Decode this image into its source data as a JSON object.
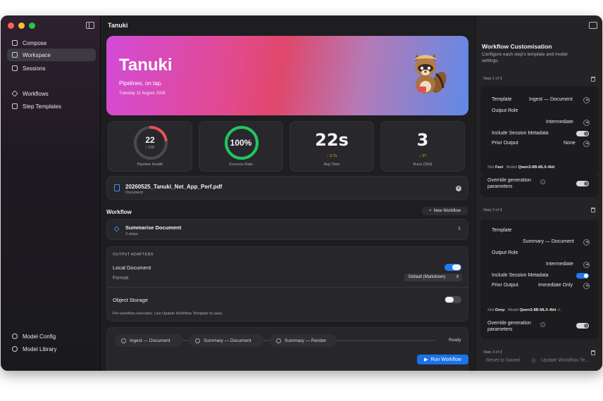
{
  "app": {
    "window_title": "Tanuki"
  },
  "sidebar": {
    "items": [
      {
        "label": "Compose",
        "icon": "compose-icon"
      },
      {
        "label": "Workspace",
        "icon": "workspace-icon"
      },
      {
        "label": "Sessions",
        "icon": "sessions-icon"
      },
      {
        "label": "Workflows",
        "icon": "workflows-icon"
      },
      {
        "label": "Step Templates",
        "icon": "step-templates-icon"
      },
      {
        "label": "Model Config",
        "icon": "model-config-icon"
      },
      {
        "label": "Model Library",
        "icon": "model-library-icon"
      }
    ]
  },
  "hero": {
    "title": "Tanuki",
    "subtitle": "Pipelines, on tap.",
    "date": "Tuesday 11 August 2026"
  },
  "stats": [
    {
      "value": "22",
      "sub": "/ 100",
      "label": "Pipeline Health",
      "level": 0.22
    },
    {
      "value": "100%",
      "label": "Success Rate",
      "level": 1.0
    },
    {
      "value": "22s",
      "delta": "↑ 3.7s",
      "label": "Avg Time"
    },
    {
      "value": "3",
      "delta": "↓ 27",
      "label": "Runs (30d)"
    }
  ],
  "document": {
    "name": "20260525_Tanuki_Net_App_Perf.pdf",
    "type": "Document"
  },
  "workflow": {
    "section_title": "Workflow",
    "new_button": "New Workflow",
    "selected": {
      "name": "Summarise Document",
      "steps": "3 steps"
    },
    "adapters_title": "OUTPUT ADAPTERS",
    "local_document": "Local Document",
    "format_label": "Format",
    "format_value": "Default (Markdown)",
    "object_storage": "Object Storage",
    "note": "Per-workflow overrides. Use Update Workflow Template to save.",
    "steps": [
      "Ingest — Document",
      "Summary — Document",
      "Summary — Render"
    ],
    "status": "Ready",
    "run_button": "Run Workflow"
  },
  "panel": {
    "title": "Workflow Customisation",
    "subtitle": "Configure each step's template and model settings.",
    "steps": [
      {
        "header": "Step 1 of 3",
        "template": "Ingest — Document",
        "role": "Intermediate",
        "metadata": false,
        "prior": "None",
        "slot": "Fast",
        "model": "Qwen3-8B-MLX-4bit",
        "override": false
      },
      {
        "header": "Step 2 of 3",
        "template": "Summary — Document",
        "role": "Intermediate",
        "metadata": true,
        "prior": "Immediate Only",
        "slot": "Deep",
        "model": "Qwen3-8B-MLX-4bit",
        "override": false
      },
      {
        "header": "Step 3 of 3"
      }
    ],
    "labels": {
      "template": "Template",
      "output_role": "Output Role",
      "include_metadata": "Include Session Metadata",
      "prior_output": "Prior Output",
      "slot": "Slot",
      "model": "Model",
      "override": "Override generation parameters"
    },
    "reset_button": "Reset to Saved",
    "update_button": "Update Workflow Te..."
  },
  "colors": {
    "accent": "#1f7cf0",
    "health_ring": "#e8505b",
    "success_ring": "#22c55e",
    "up": "#f5a623",
    "down": "#f5a623"
  }
}
